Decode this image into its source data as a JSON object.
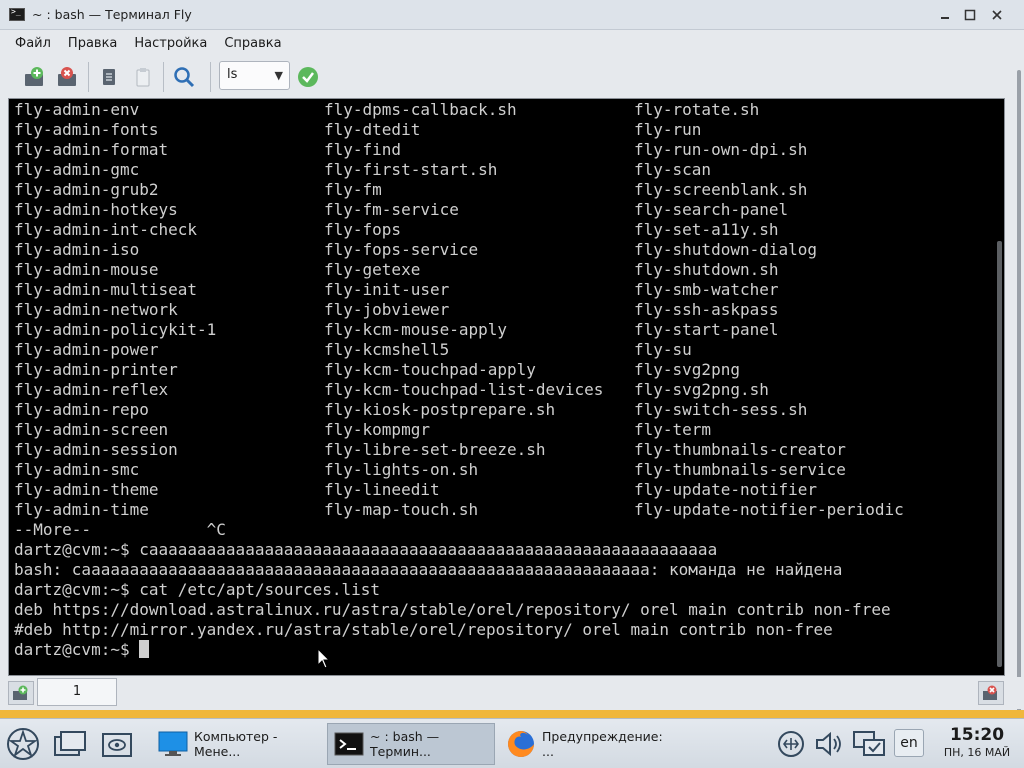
{
  "window": {
    "title": "~ : bash — Терминал Fly"
  },
  "menu": [
    "Файл",
    "Правка",
    "Настройка",
    "Справка"
  ],
  "toolbar": {
    "command_value": "ls"
  },
  "terminal": {
    "columns": [
      [
        "fly-admin-env",
        "fly-admin-fonts",
        "fly-admin-format",
        "fly-admin-gmc",
        "fly-admin-grub2",
        "fly-admin-hotkeys",
        "fly-admin-int-check",
        "fly-admin-iso",
        "fly-admin-mouse",
        "fly-admin-multiseat",
        "fly-admin-network",
        "fly-admin-policykit-1",
        "fly-admin-power",
        "fly-admin-printer",
        "fly-admin-reflex",
        "fly-admin-repo",
        "fly-admin-screen",
        "fly-admin-session",
        "fly-admin-smc",
        "fly-admin-theme",
        "fly-admin-time"
      ],
      [
        "fly-dpms-callback.sh",
        "fly-dtedit",
        "fly-find",
        "fly-first-start.sh",
        "fly-fm",
        "fly-fm-service",
        "fly-fops",
        "fly-fops-service",
        "fly-getexe",
        "fly-init-user",
        "fly-jobviewer",
        "fly-kcm-mouse-apply",
        "fly-kcmshell5",
        "fly-kcm-touchpad-apply",
        "fly-kcm-touchpad-list-devices",
        "fly-kiosk-postprepare.sh",
        "fly-kompmgr",
        "fly-libre-set-breeze.sh",
        "fly-lights-on.sh",
        "fly-lineedit",
        "fly-map-touch.sh"
      ],
      [
        "fly-rotate.sh",
        "fly-run",
        "fly-run-own-dpi.sh",
        "fly-scan",
        "fly-screenblank.sh",
        "fly-search-panel",
        "fly-set-a11y.sh",
        "fly-shutdown-dialog",
        "fly-shutdown.sh",
        "fly-smb-watcher",
        "fly-ssh-askpass",
        "fly-start-panel",
        "fly-su",
        "fly-svg2png",
        "fly-svg2png.sh",
        "fly-switch-sess.sh",
        "fly-term",
        "fly-thumbnails-creator",
        "fly-thumbnails-service",
        "fly-update-notifier",
        "fly-update-notifier-periodic"
      ]
    ],
    "more_line": "--More--            ^C",
    "lines": [
      "dartz@cvm:~$ caaaaaaaaaaaaaaaaaaaaaaaaaaaaaaaaaaaaaaaaaaaaaaaaaaaaaaaaaaa",
      "bash: caaaaaaaaaaaaaaaaaaaaaaaaaaaaaaaaaaaaaaaaaaaaaaaaaaaaaaaaaaa: команда не найдена",
      "dartz@cvm:~$ cat /etc/apt/sources.list",
      "deb https://download.astralinux.ru/astra/stable/orel/repository/ orel main contrib non-free",
      "#deb http://mirror.yandex.ru/astra/stable/orel/repository/ orel main contrib non-free"
    ],
    "prompt": "dartz@cvm:~$ "
  },
  "tabs": [
    {
      "label": "1"
    }
  ],
  "taskbar": {
    "tasks": [
      {
        "label": "Компьютер - Мене..."
      },
      {
        "label": "~ : bash — Термин..."
      },
      {
        "label": "Предупреждение: ..."
      }
    ],
    "lang": "en",
    "time": "15:20",
    "date": "ПН, 16 МАЙ"
  },
  "colors": {
    "terminal_bg": "#000000",
    "terminal_fg": "#cfcfcf",
    "accent": "#f0b73c"
  }
}
